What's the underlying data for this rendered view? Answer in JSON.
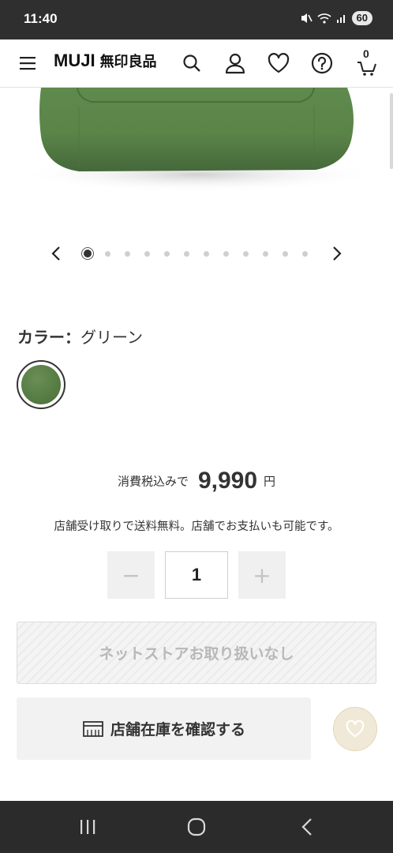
{
  "status_bar": {
    "time": "11:40",
    "battery": "60"
  },
  "header": {
    "logo_en": "MUJI",
    "logo_jp": "無印良品",
    "cart_count": "0",
    "icons": [
      "menu-icon",
      "search-icon",
      "account-icon",
      "heart-icon",
      "help-icon",
      "cart-icon"
    ]
  },
  "carousel": {
    "slide_count": 12,
    "active_index": 0
  },
  "color": {
    "label": "カラー：",
    "value": "グリーン",
    "swatch_color": "#567c43"
  },
  "price": {
    "prefix": "消費税込みで",
    "amount": "9,990",
    "unit": "円"
  },
  "notice": "店舗受け取りで送料無料。店舗でお支払いも可能です。",
  "quantity": {
    "minus": "−",
    "value": "1",
    "plus": "+"
  },
  "buttons": {
    "unavailable": "ネットストアお取り扱いなし",
    "check_store": "店舗在庫を確認する"
  },
  "colors": {
    "status_bar_bg": "#2f2f2f",
    "nav_bar_bg": "#2b2b2b",
    "fav_button_bg": "#f1e9d7"
  }
}
